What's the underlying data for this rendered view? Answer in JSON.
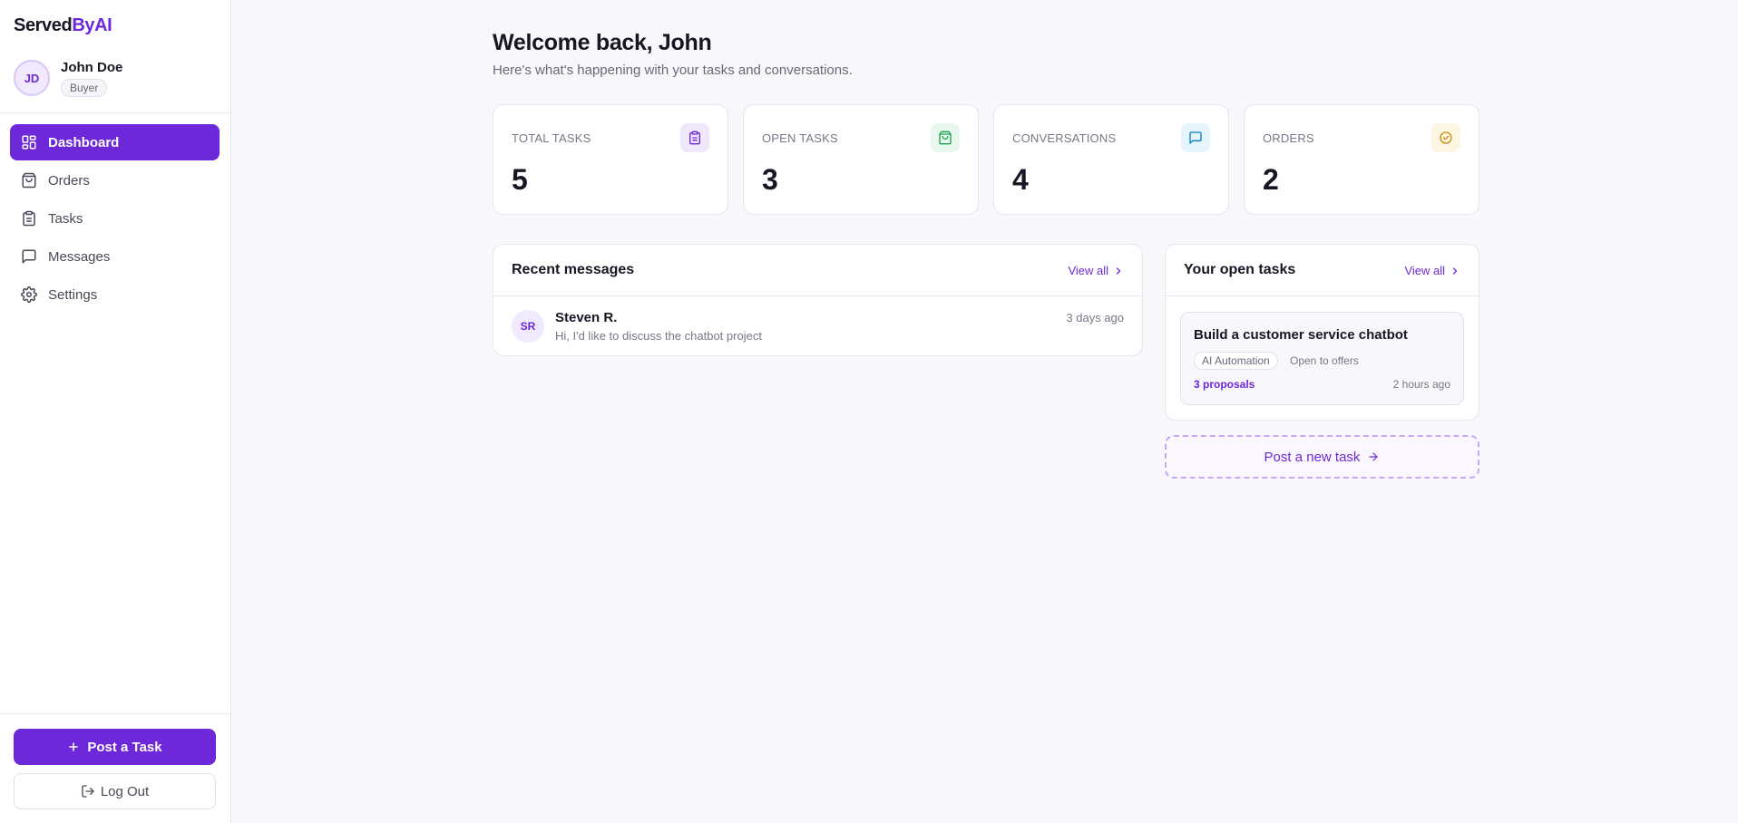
{
  "brand": {
    "part1": "Served",
    "part2": "ByAI"
  },
  "user": {
    "initials": "JD",
    "name": "John Doe",
    "role": "Buyer"
  },
  "nav": [
    {
      "label": "Dashboard",
      "icon": "dashboard-grid-icon",
      "active": true
    },
    {
      "label": "Orders",
      "icon": "shopping-bag-icon",
      "active": false
    },
    {
      "label": "Tasks",
      "icon": "clipboard-icon",
      "active": false
    },
    {
      "label": "Messages",
      "icon": "message-icon",
      "active": false
    },
    {
      "label": "Settings",
      "icon": "gear-icon",
      "active": false
    }
  ],
  "sidebar_actions": {
    "post_task": "Post a Task",
    "logout": "Log Out"
  },
  "header": {
    "title": "Welcome back, John",
    "subtitle": "Here's what's happening with your tasks and conversations."
  },
  "stats": [
    {
      "label": "TOTAL TASKS",
      "value": "5",
      "icon": "clipboard-icon",
      "color": "#6d28d9",
      "bg": "#efe7fc"
    },
    {
      "label": "OPEN TASKS",
      "value": "3",
      "icon": "shopping-bag-icon",
      "color": "#16a34a",
      "bg": "#e8f8ee"
    },
    {
      "label": "CONVERSATIONS",
      "value": "4",
      "icon": "message-icon",
      "color": "#0284c7",
      "bg": "#e6f4fb"
    },
    {
      "label": "ORDERS",
      "value": "2",
      "icon": "check-circle-icon",
      "color": "#ca8a04",
      "bg": "#fdf6e3"
    }
  ],
  "messages_panel": {
    "title": "Recent messages",
    "view_all": "View all",
    "items": [
      {
        "initials": "SR",
        "name": "Steven R.",
        "preview": "Hi, I'd like to discuss the chatbot project",
        "time": "3 days ago"
      }
    ]
  },
  "tasks_panel": {
    "title": "Your open tasks",
    "view_all": "View all",
    "items": [
      {
        "title": "Build a customer service chatbot",
        "tag": "AI Automation",
        "status": "Open to offers",
        "proposals": "3 proposals",
        "time": "2 hours ago"
      }
    ]
  },
  "new_task_button": "Post a new task"
}
